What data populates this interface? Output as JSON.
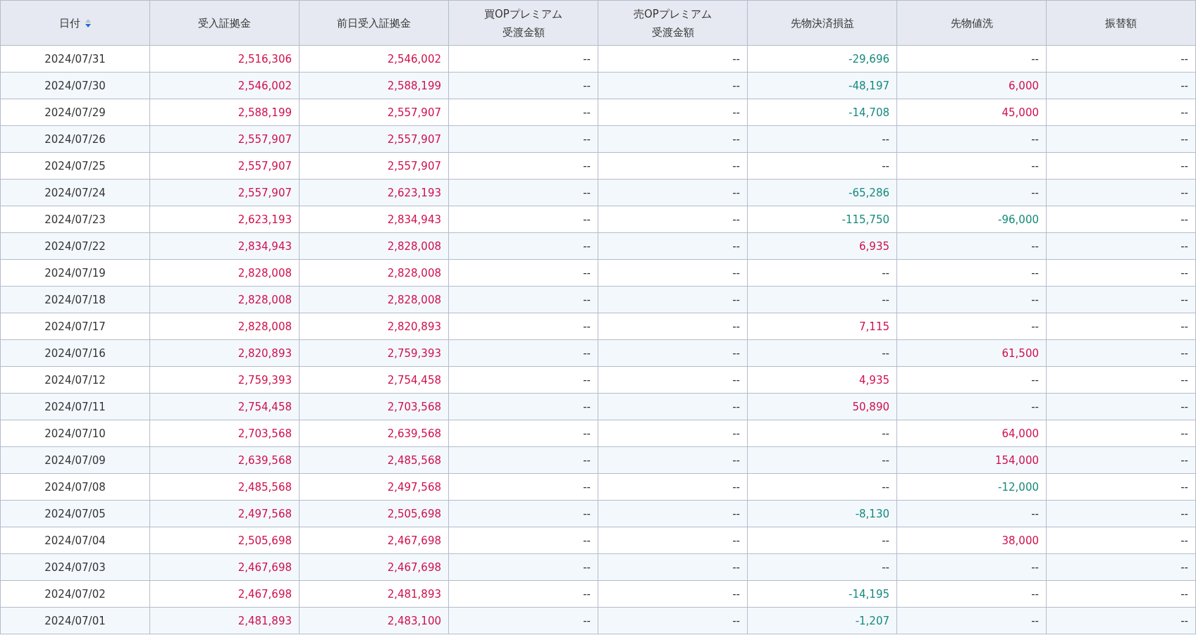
{
  "table": {
    "columns": [
      {
        "lines": [
          "日付"
        ],
        "sorted": true
      },
      {
        "lines": [
          "受入証拠金"
        ],
        "sorted": false
      },
      {
        "lines": [
          "前日受入証拠金"
        ],
        "sorted": false
      },
      {
        "lines": [
          "買OPプレミアム",
          "受渡金額"
        ],
        "sorted": false
      },
      {
        "lines": [
          "売OPプレミアム",
          "受渡金額"
        ],
        "sorted": false
      },
      {
        "lines": [
          "先物決済損益"
        ],
        "sorted": false
      },
      {
        "lines": [
          "先物値洗"
        ],
        "sorted": false
      },
      {
        "lines": [
          "振替額"
        ],
        "sorted": false
      }
    ],
    "rows": [
      {
        "cells": [
          {
            "text": "2024/07/31",
            "color": "#333333"
          },
          {
            "text": "2,516,306",
            "color": "#d0104c"
          },
          {
            "text": "2,546,002",
            "color": "#d0104c"
          },
          {
            "text": "--",
            "color": "#333333"
          },
          {
            "text": "--",
            "color": "#333333"
          },
          {
            "text": "-29,696",
            "color": "#158a7c"
          },
          {
            "text": "--",
            "color": "#333333"
          },
          {
            "text": "--",
            "color": "#333333"
          }
        ]
      },
      {
        "cells": [
          {
            "text": "2024/07/30",
            "color": "#333333"
          },
          {
            "text": "2,546,002",
            "color": "#d0104c"
          },
          {
            "text": "2,588,199",
            "color": "#d0104c"
          },
          {
            "text": "--",
            "color": "#333333"
          },
          {
            "text": "--",
            "color": "#333333"
          },
          {
            "text": "-48,197",
            "color": "#158a7c"
          },
          {
            "text": "6,000",
            "color": "#d0104c"
          },
          {
            "text": "--",
            "color": "#333333"
          }
        ]
      },
      {
        "cells": [
          {
            "text": "2024/07/29",
            "color": "#333333"
          },
          {
            "text": "2,588,199",
            "color": "#d0104c"
          },
          {
            "text": "2,557,907",
            "color": "#d0104c"
          },
          {
            "text": "--",
            "color": "#333333"
          },
          {
            "text": "--",
            "color": "#333333"
          },
          {
            "text": "-14,708",
            "color": "#158a7c"
          },
          {
            "text": "45,000",
            "color": "#d0104c"
          },
          {
            "text": "--",
            "color": "#333333"
          }
        ]
      },
      {
        "cells": [
          {
            "text": "2024/07/26",
            "color": "#333333"
          },
          {
            "text": "2,557,907",
            "color": "#d0104c"
          },
          {
            "text": "2,557,907",
            "color": "#d0104c"
          },
          {
            "text": "--",
            "color": "#333333"
          },
          {
            "text": "--",
            "color": "#333333"
          },
          {
            "text": "--",
            "color": "#333333"
          },
          {
            "text": "--",
            "color": "#333333"
          },
          {
            "text": "--",
            "color": "#333333"
          }
        ]
      },
      {
        "cells": [
          {
            "text": "2024/07/25",
            "color": "#333333"
          },
          {
            "text": "2,557,907",
            "color": "#d0104c"
          },
          {
            "text": "2,557,907",
            "color": "#d0104c"
          },
          {
            "text": "--",
            "color": "#333333"
          },
          {
            "text": "--",
            "color": "#333333"
          },
          {
            "text": "--",
            "color": "#333333"
          },
          {
            "text": "--",
            "color": "#333333"
          },
          {
            "text": "--",
            "color": "#333333"
          }
        ]
      },
      {
        "cells": [
          {
            "text": "2024/07/24",
            "color": "#333333"
          },
          {
            "text": "2,557,907",
            "color": "#d0104c"
          },
          {
            "text": "2,623,193",
            "color": "#d0104c"
          },
          {
            "text": "--",
            "color": "#333333"
          },
          {
            "text": "--",
            "color": "#333333"
          },
          {
            "text": "-65,286",
            "color": "#158a7c"
          },
          {
            "text": "--",
            "color": "#333333"
          },
          {
            "text": "--",
            "color": "#333333"
          }
        ]
      },
      {
        "cells": [
          {
            "text": "2024/07/23",
            "color": "#333333"
          },
          {
            "text": "2,623,193",
            "color": "#d0104c"
          },
          {
            "text": "2,834,943",
            "color": "#d0104c"
          },
          {
            "text": "--",
            "color": "#333333"
          },
          {
            "text": "--",
            "color": "#333333"
          },
          {
            "text": "-115,750",
            "color": "#158a7c"
          },
          {
            "text": "-96,000",
            "color": "#158a7c"
          },
          {
            "text": "--",
            "color": "#333333"
          }
        ]
      },
      {
        "cells": [
          {
            "text": "2024/07/22",
            "color": "#333333"
          },
          {
            "text": "2,834,943",
            "color": "#d0104c"
          },
          {
            "text": "2,828,008",
            "color": "#d0104c"
          },
          {
            "text": "--",
            "color": "#333333"
          },
          {
            "text": "--",
            "color": "#333333"
          },
          {
            "text": "6,935",
            "color": "#d0104c"
          },
          {
            "text": "--",
            "color": "#333333"
          },
          {
            "text": "--",
            "color": "#333333"
          }
        ]
      },
      {
        "cells": [
          {
            "text": "2024/07/19",
            "color": "#333333"
          },
          {
            "text": "2,828,008",
            "color": "#d0104c"
          },
          {
            "text": "2,828,008",
            "color": "#d0104c"
          },
          {
            "text": "--",
            "color": "#333333"
          },
          {
            "text": "--",
            "color": "#333333"
          },
          {
            "text": "--",
            "color": "#333333"
          },
          {
            "text": "--",
            "color": "#333333"
          },
          {
            "text": "--",
            "color": "#333333"
          }
        ]
      },
      {
        "cells": [
          {
            "text": "2024/07/18",
            "color": "#333333"
          },
          {
            "text": "2,828,008",
            "color": "#d0104c"
          },
          {
            "text": "2,828,008",
            "color": "#d0104c"
          },
          {
            "text": "--",
            "color": "#333333"
          },
          {
            "text": "--",
            "color": "#333333"
          },
          {
            "text": "--",
            "color": "#333333"
          },
          {
            "text": "--",
            "color": "#333333"
          },
          {
            "text": "--",
            "color": "#333333"
          }
        ]
      },
      {
        "cells": [
          {
            "text": "2024/07/17",
            "color": "#333333"
          },
          {
            "text": "2,828,008",
            "color": "#d0104c"
          },
          {
            "text": "2,820,893",
            "color": "#d0104c"
          },
          {
            "text": "--",
            "color": "#333333"
          },
          {
            "text": "--",
            "color": "#333333"
          },
          {
            "text": "7,115",
            "color": "#d0104c"
          },
          {
            "text": "--",
            "color": "#333333"
          },
          {
            "text": "--",
            "color": "#333333"
          }
        ]
      },
      {
        "cells": [
          {
            "text": "2024/07/16",
            "color": "#333333"
          },
          {
            "text": "2,820,893",
            "color": "#d0104c"
          },
          {
            "text": "2,759,393",
            "color": "#d0104c"
          },
          {
            "text": "--",
            "color": "#333333"
          },
          {
            "text": "--",
            "color": "#333333"
          },
          {
            "text": "--",
            "color": "#333333"
          },
          {
            "text": "61,500",
            "color": "#d0104c"
          },
          {
            "text": "--",
            "color": "#333333"
          }
        ]
      },
      {
        "cells": [
          {
            "text": "2024/07/12",
            "color": "#333333"
          },
          {
            "text": "2,759,393",
            "color": "#d0104c"
          },
          {
            "text": "2,754,458",
            "color": "#d0104c"
          },
          {
            "text": "--",
            "color": "#333333"
          },
          {
            "text": "--",
            "color": "#333333"
          },
          {
            "text": "4,935",
            "color": "#d0104c"
          },
          {
            "text": "--",
            "color": "#333333"
          },
          {
            "text": "--",
            "color": "#333333"
          }
        ]
      },
      {
        "cells": [
          {
            "text": "2024/07/11",
            "color": "#333333"
          },
          {
            "text": "2,754,458",
            "color": "#d0104c"
          },
          {
            "text": "2,703,568",
            "color": "#d0104c"
          },
          {
            "text": "--",
            "color": "#333333"
          },
          {
            "text": "--",
            "color": "#333333"
          },
          {
            "text": "50,890",
            "color": "#d0104c"
          },
          {
            "text": "--",
            "color": "#333333"
          },
          {
            "text": "--",
            "color": "#333333"
          }
        ]
      },
      {
        "cells": [
          {
            "text": "2024/07/10",
            "color": "#333333"
          },
          {
            "text": "2,703,568",
            "color": "#d0104c"
          },
          {
            "text": "2,639,568",
            "color": "#d0104c"
          },
          {
            "text": "--",
            "color": "#333333"
          },
          {
            "text": "--",
            "color": "#333333"
          },
          {
            "text": "--",
            "color": "#333333"
          },
          {
            "text": "64,000",
            "color": "#d0104c"
          },
          {
            "text": "--",
            "color": "#333333"
          }
        ]
      },
      {
        "cells": [
          {
            "text": "2024/07/09",
            "color": "#333333"
          },
          {
            "text": "2,639,568",
            "color": "#d0104c"
          },
          {
            "text": "2,485,568",
            "color": "#d0104c"
          },
          {
            "text": "--",
            "color": "#333333"
          },
          {
            "text": "--",
            "color": "#333333"
          },
          {
            "text": "--",
            "color": "#333333"
          },
          {
            "text": "154,000",
            "color": "#d0104c"
          },
          {
            "text": "--",
            "color": "#333333"
          }
        ]
      },
      {
        "cells": [
          {
            "text": "2024/07/08",
            "color": "#333333"
          },
          {
            "text": "2,485,568",
            "color": "#d0104c"
          },
          {
            "text": "2,497,568",
            "color": "#d0104c"
          },
          {
            "text": "--",
            "color": "#333333"
          },
          {
            "text": "--",
            "color": "#333333"
          },
          {
            "text": "--",
            "color": "#333333"
          },
          {
            "text": "-12,000",
            "color": "#158a7c"
          },
          {
            "text": "--",
            "color": "#333333"
          }
        ]
      },
      {
        "cells": [
          {
            "text": "2024/07/05",
            "color": "#333333"
          },
          {
            "text": "2,497,568",
            "color": "#d0104c"
          },
          {
            "text": "2,505,698",
            "color": "#d0104c"
          },
          {
            "text": "--",
            "color": "#333333"
          },
          {
            "text": "--",
            "color": "#333333"
          },
          {
            "text": "-8,130",
            "color": "#158a7c"
          },
          {
            "text": "--",
            "color": "#333333"
          },
          {
            "text": "--",
            "color": "#333333"
          }
        ]
      },
      {
        "cells": [
          {
            "text": "2024/07/04",
            "color": "#333333"
          },
          {
            "text": "2,505,698",
            "color": "#d0104c"
          },
          {
            "text": "2,467,698",
            "color": "#d0104c"
          },
          {
            "text": "--",
            "color": "#333333"
          },
          {
            "text": "--",
            "color": "#333333"
          },
          {
            "text": "--",
            "color": "#333333"
          },
          {
            "text": "38,000",
            "color": "#d0104c"
          },
          {
            "text": "--",
            "color": "#333333"
          }
        ]
      },
      {
        "cells": [
          {
            "text": "2024/07/03",
            "color": "#333333"
          },
          {
            "text": "2,467,698",
            "color": "#d0104c"
          },
          {
            "text": "2,467,698",
            "color": "#d0104c"
          },
          {
            "text": "--",
            "color": "#333333"
          },
          {
            "text": "--",
            "color": "#333333"
          },
          {
            "text": "--",
            "color": "#333333"
          },
          {
            "text": "--",
            "color": "#333333"
          },
          {
            "text": "--",
            "color": "#333333"
          }
        ]
      },
      {
        "cells": [
          {
            "text": "2024/07/02",
            "color": "#333333"
          },
          {
            "text": "2,467,698",
            "color": "#d0104c"
          },
          {
            "text": "2,481,893",
            "color": "#d0104c"
          },
          {
            "text": "--",
            "color": "#333333"
          },
          {
            "text": "--",
            "color": "#333333"
          },
          {
            "text": "-14,195",
            "color": "#158a7c"
          },
          {
            "text": "--",
            "color": "#333333"
          },
          {
            "text": "--",
            "color": "#333333"
          }
        ]
      },
      {
        "cells": [
          {
            "text": "2024/07/01",
            "color": "#333333"
          },
          {
            "text": "2,481,893",
            "color": "#d0104c"
          },
          {
            "text": "2,483,100",
            "color": "#d0104c"
          },
          {
            "text": "--",
            "color": "#333333"
          },
          {
            "text": "--",
            "color": "#333333"
          },
          {
            "text": "-1,207",
            "color": "#158a7c"
          },
          {
            "text": "--",
            "color": "#333333"
          },
          {
            "text": "--",
            "color": "#333333"
          }
        ]
      }
    ]
  }
}
